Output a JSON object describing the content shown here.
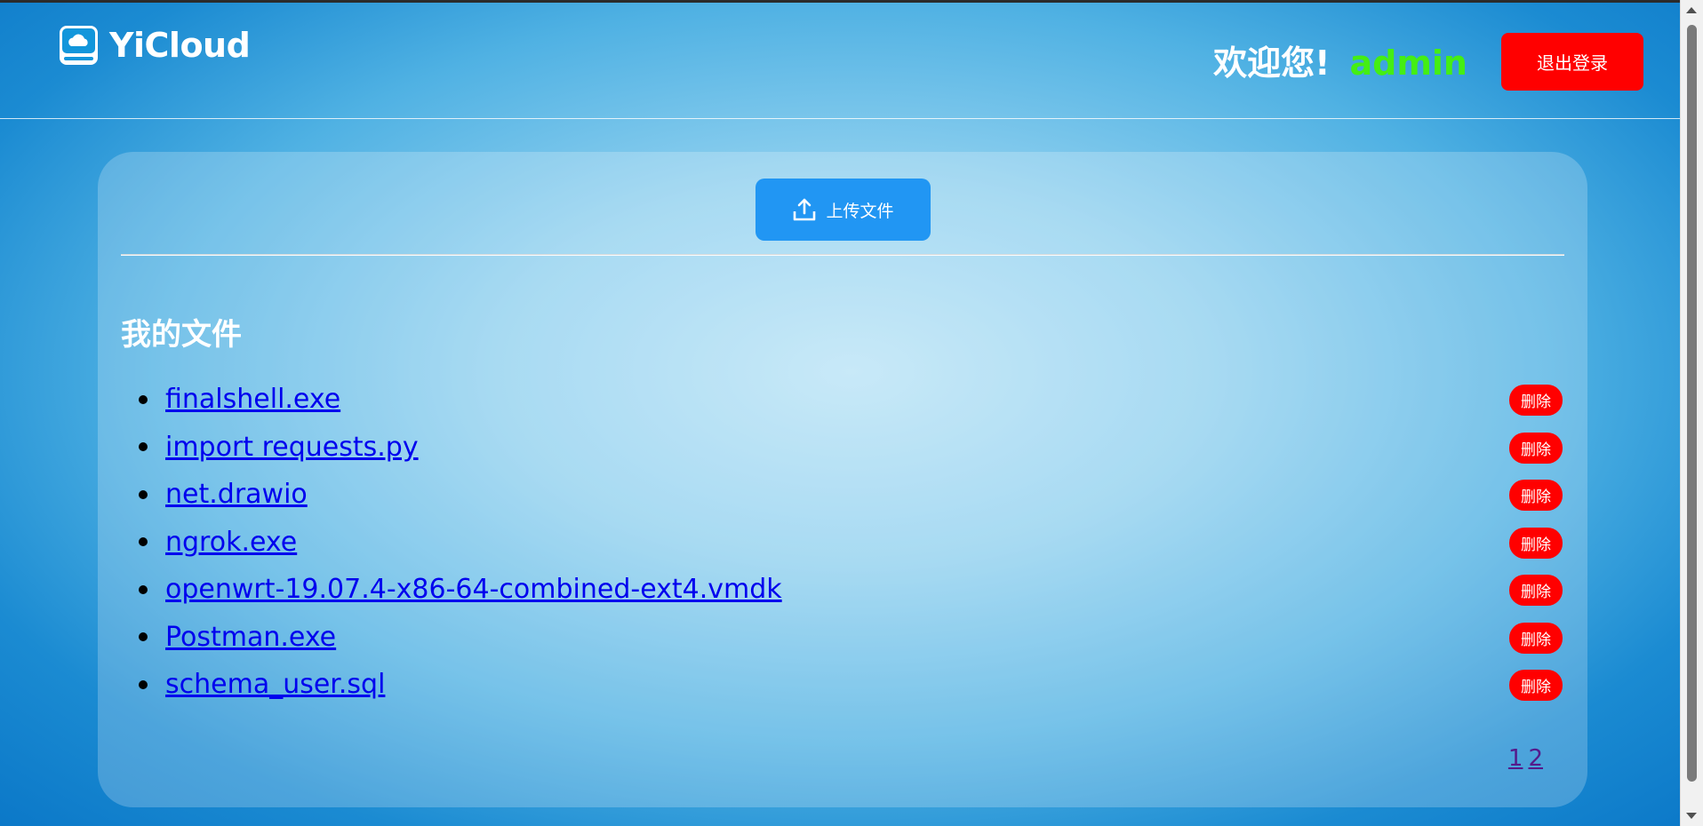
{
  "header": {
    "logo_text": "YiCloud",
    "logo_icon": "cloud-drive-icon",
    "welcome_text": "欢迎您!",
    "username": "admin",
    "logout_label": "退出登录"
  },
  "main": {
    "upload_label": "上传文件",
    "upload_icon": "upload-icon",
    "section_title": "我的文件",
    "files": [
      {
        "name": "finalshell.exe",
        "delete_label": "删除"
      },
      {
        "name": "import requests.py",
        "delete_label": "删除"
      },
      {
        "name": "net.drawio",
        "delete_label": "删除"
      },
      {
        "name": "ngrok.exe",
        "delete_label": "删除"
      },
      {
        "name": "openwrt-19.07.4-x86-64-combined-ext4.vmdk",
        "delete_label": "删除"
      },
      {
        "name": "Postman.exe",
        "delete_label": "删除"
      },
      {
        "name": "schema_user.sql",
        "delete_label": "删除"
      }
    ],
    "pagination": [
      "1",
      "2"
    ]
  },
  "colors": {
    "accent_blue": "#2196f3",
    "danger_red": "#ff0000",
    "username_green": "#44ee14",
    "link_blue": "#0000ee"
  }
}
